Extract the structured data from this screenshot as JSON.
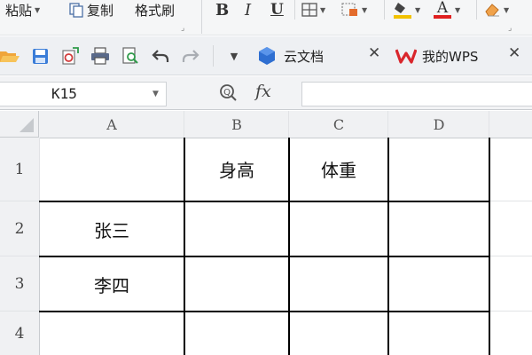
{
  "ribbon": {
    "paste_label": "粘贴",
    "copy_label": "复制",
    "format_painter_label": "格式刷",
    "bold_label": "B",
    "italic_label": "I",
    "underline_label": "U",
    "font_color_label": "A",
    "colors": {
      "fill": "#f2c200",
      "font": "#e02020"
    }
  },
  "tabs": [
    {
      "label": "云文档"
    },
    {
      "label": "我的WPS"
    }
  ],
  "formula_bar": {
    "name_box": "K15",
    "fx_label": "fx",
    "formula_value": ""
  },
  "sheet": {
    "columns": [
      "A",
      "B",
      "C",
      "D"
    ],
    "rows": [
      "1",
      "2",
      "3",
      "4"
    ],
    "cells": {
      "B1": "身高",
      "C1": "体重",
      "A2": "张三",
      "A3": "李四"
    }
  }
}
